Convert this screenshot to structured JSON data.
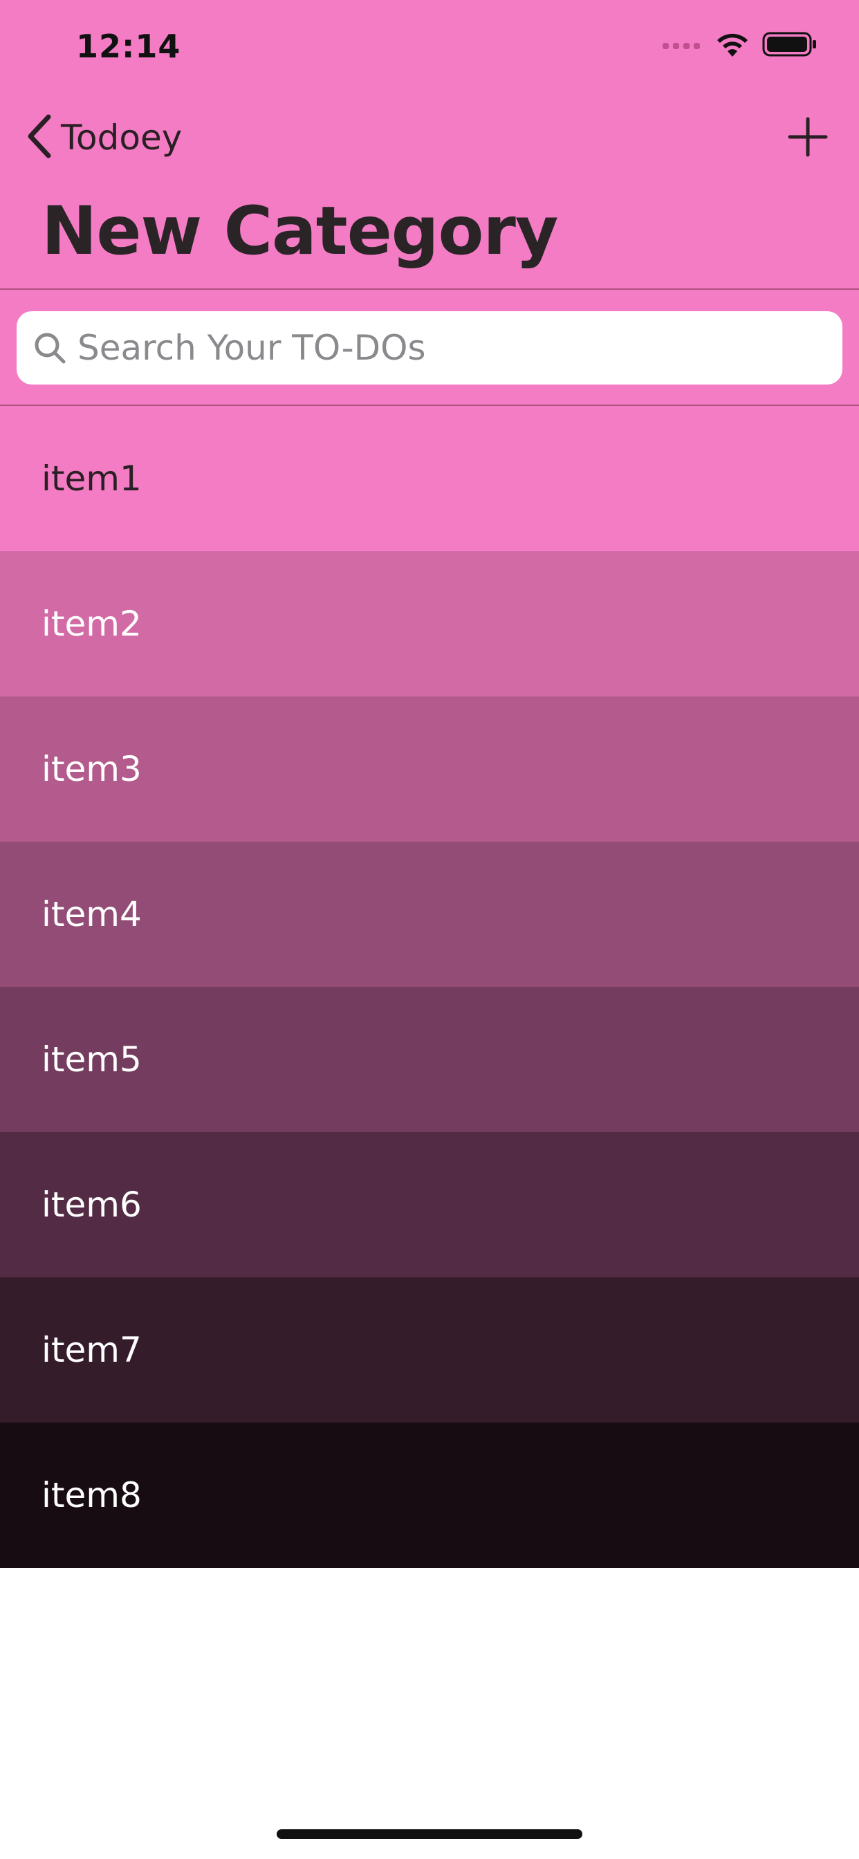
{
  "status_bar": {
    "time": "12:14"
  },
  "nav": {
    "back_label": "Todoey",
    "back_icon": "chevron-left-icon",
    "add_icon": "plus-icon"
  },
  "title": "New Category",
  "search": {
    "placeholder": "Search Your TO-DOs",
    "value": "",
    "icon": "search-icon"
  },
  "colors": {
    "accent": "#f47cc4",
    "title_text": "#2a2427",
    "placeholder": "#8a8a8e"
  },
  "items": [
    {
      "label": "item1",
      "bg": "#f47cc4",
      "fg": "#2a1f24"
    },
    {
      "label": "item2",
      "bg": "#d26aa6",
      "fg": "#ffffff"
    },
    {
      "label": "item3",
      "bg": "#b35b8d",
      "fg": "#ffffff"
    },
    {
      "label": "item4",
      "bg": "#924c75",
      "fg": "#ffffff"
    },
    {
      "label": "item5",
      "bg": "#743c5e",
      "fg": "#ffffff"
    },
    {
      "label": "item6",
      "bg": "#542b44",
      "fg": "#ffffff"
    },
    {
      "label": "item7",
      "bg": "#341c2a",
      "fg": "#ffffff"
    },
    {
      "label": "item8",
      "bg": "#170c12",
      "fg": "#ffffff"
    }
  ]
}
